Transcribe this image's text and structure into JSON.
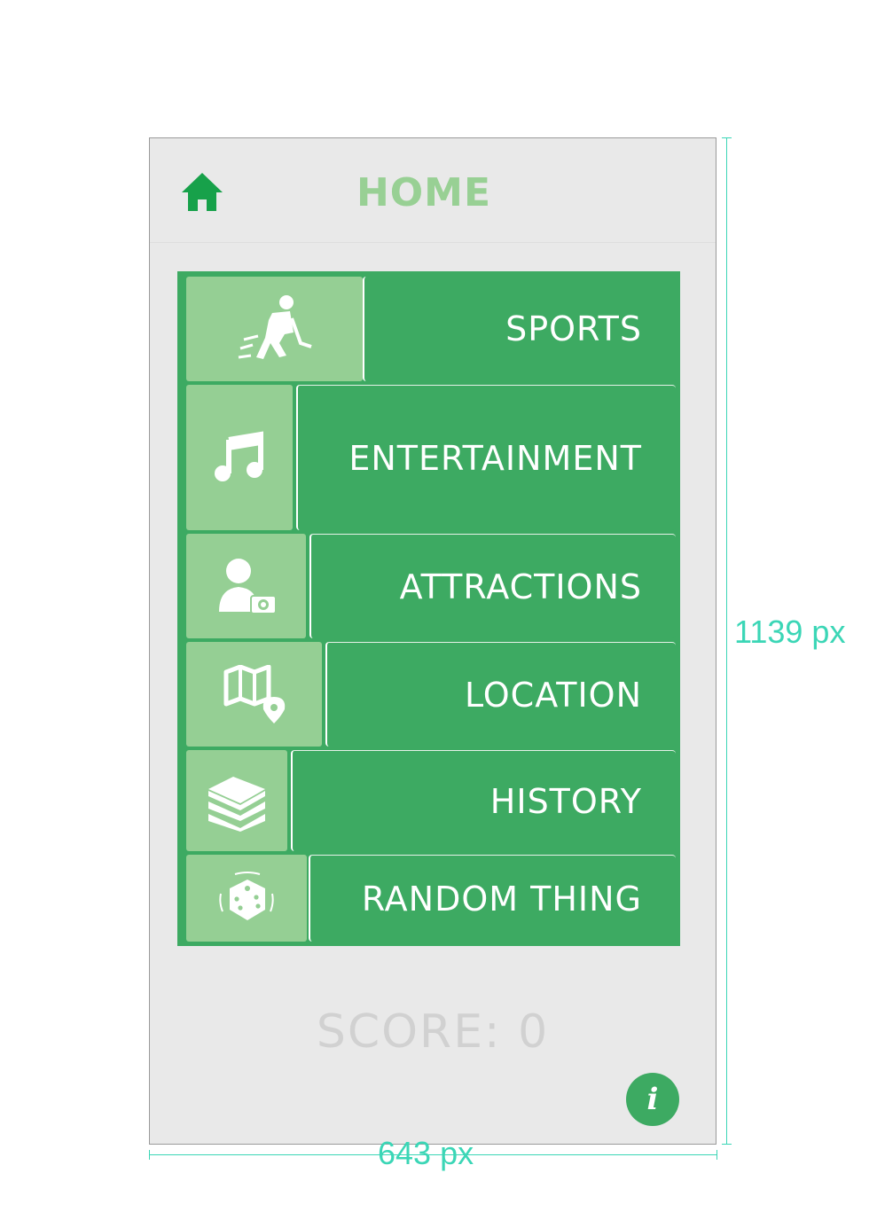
{
  "header": {
    "title": "HOME",
    "home_icon": "home-icon"
  },
  "menu": {
    "items": [
      {
        "label": "SPORTS",
        "icon": "hockey-player-icon"
      },
      {
        "label": "ENTERTAINMENT",
        "icon": "music-note-icon"
      },
      {
        "label": "ATTRACTIONS",
        "icon": "tourist-camera-icon"
      },
      {
        "label": "LOCATION",
        "icon": "map-pin-icon"
      },
      {
        "label": "HISTORY",
        "icon": "books-icon"
      },
      {
        "label": "RANDOM THING",
        "icon": "dice-icon"
      }
    ]
  },
  "score": {
    "text": "SCORE: 0"
  },
  "info": {
    "glyph": "i",
    "icon": "info-icon"
  },
  "annotations": {
    "height": "1139 px",
    "width": "643 px"
  },
  "colors": {
    "accent_green": "#3daa62",
    "tile_green": "#95cf94",
    "title_green": "#98d094",
    "home_icon_green": "#17a14a",
    "background": "#e9e9e9",
    "score_gray": "#d1d1d1",
    "dimension_teal": "#3bd6b6"
  }
}
